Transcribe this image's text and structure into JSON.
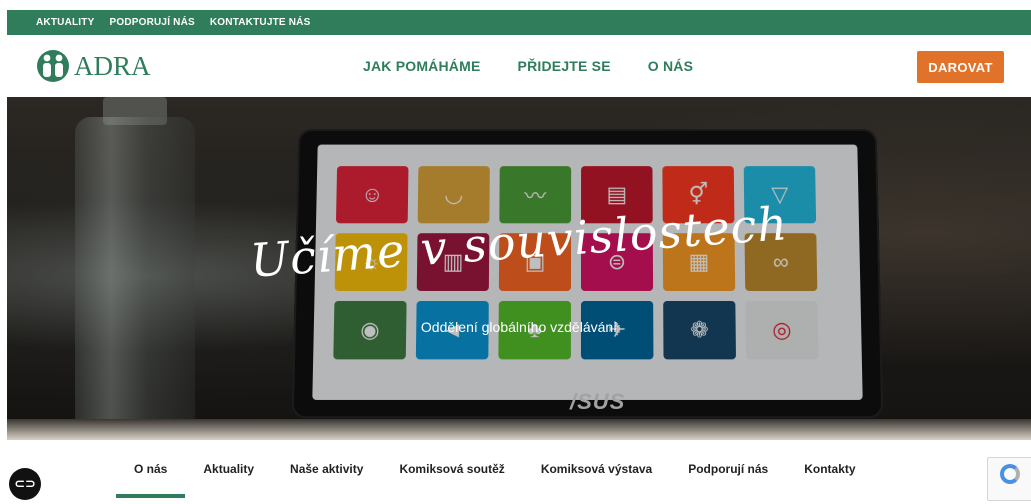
{
  "topbar": {
    "links": [
      "AKTUALITY",
      "PODPORUJÍ NÁS",
      "KONTAKTUJTE NÁS"
    ]
  },
  "logo": {
    "text": "ADRA"
  },
  "nav": {
    "links": [
      "JAK POMÁHÁME",
      "PŘIDEJTE SE",
      "O NÁS"
    ],
    "donate": "DAROVAT"
  },
  "hero": {
    "title": "Učíme v souvislostech",
    "subtitle": "Oddělení globálního vzdělávání",
    "laptop_brand": "/SUS"
  },
  "subnav": {
    "items": [
      "O nás",
      "Aktuality",
      "Naše aktivity",
      "Komiksová soutěž",
      "Komiksová výstava",
      "Podporují nás",
      "Kontakty"
    ],
    "active": "O nás"
  },
  "colors": {
    "brand_green": "#2f7d5b",
    "donate_orange": "#e0722a"
  },
  "icons": {
    "chat": "chat-bubble-icon",
    "captcha": "recaptcha-icon"
  }
}
